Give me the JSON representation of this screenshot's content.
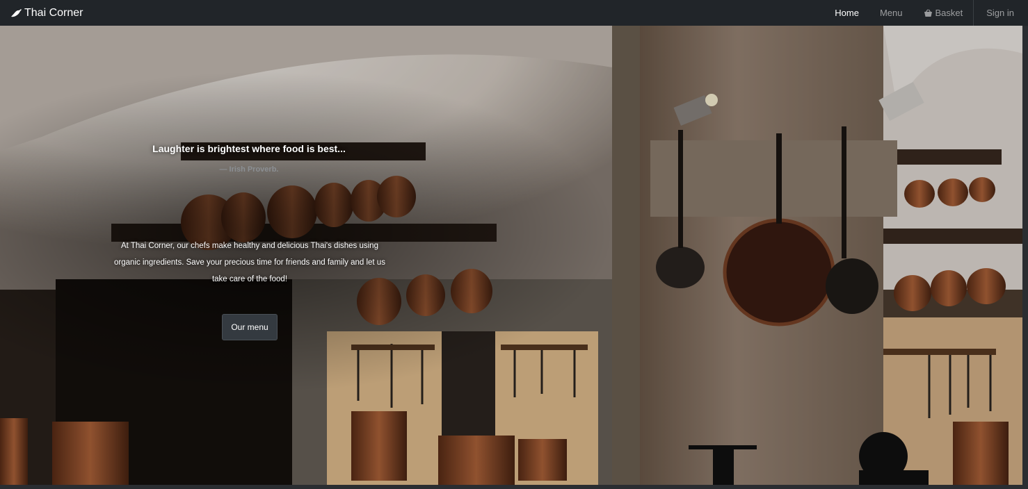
{
  "navbar": {
    "brand": "Thai Corner",
    "brand_icon": "chili-pepper-icon",
    "links": [
      {
        "label": "Home",
        "active": true
      },
      {
        "label": "Menu",
        "active": false
      },
      {
        "label": "Basket",
        "active": false,
        "icon": "basket-icon"
      },
      {
        "label": "Sign in",
        "active": false
      }
    ]
  },
  "hero": {
    "quote": "Laughter is brightest where food is best...",
    "quote_source": "— Irish Proverb.",
    "intro": "At Thai Corner, our chefs make healthy and delicious Thai's dishes using organic ingredients. Save your precious time for friends and family and let us take care of the food!",
    "cta_label": "Our menu",
    "background_description": "vintage kitchen with copper pans"
  },
  "colors": {
    "navbar_bg": "#212529",
    "button_bg": "#343a40",
    "muted_text": "#8b8f93"
  }
}
